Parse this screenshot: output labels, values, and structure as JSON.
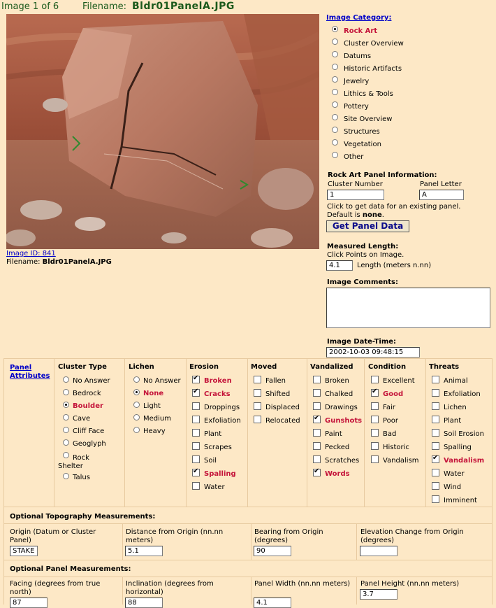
{
  "header": {
    "image_count": "Image 1 of 6",
    "filename_label": "Filename:",
    "filename": "Bldr01PanelA.JPG"
  },
  "image_info": {
    "image_id": "Image ID: 841",
    "filename_label": "Filename:",
    "filename": "Bldr01PanelA.JPG"
  },
  "category": {
    "title": "Image Category:",
    "options": [
      "Rock Art",
      "Cluster Overview",
      "Datums",
      "Historic Artifacts",
      "Jewelry",
      "Lithics & Tools",
      "Pottery",
      "Site Overview",
      "Structures",
      "Vegetation",
      "Other"
    ],
    "selected": 0
  },
  "panel_info": {
    "title": "Rock Art Panel Information:",
    "cluster_label": "Cluster Number",
    "cluster_value": "1",
    "letter_label": "Panel Letter",
    "letter_value": "A",
    "hint_line1": "Click to get data for an existing panel.",
    "hint_default": "Default is ",
    "hint_none": "none",
    "hint_period": ".",
    "button": "Get Panel Data"
  },
  "length": {
    "title": "Measured Length:",
    "hint": "Click Points on Image.",
    "value": "4.1",
    "unit_label": "Length (meters n.nn)"
  },
  "comments": {
    "title": "Image Comments:",
    "value": ""
  },
  "datetime": {
    "title": "Image Date-Time:",
    "value": "2002-10-03 09:48:15"
  },
  "attributes": {
    "title_line1": "Panel",
    "title_line2": "Attributes",
    "cluster_type": {
      "title": "Cluster Type",
      "options": [
        "No Answer",
        "Bedrock",
        "Boulder",
        "Cave",
        "Cliff Face",
        "Geoglyph",
        "Rock Shelter",
        "Talus"
      ],
      "selected": 2
    },
    "lichen": {
      "title": "Lichen",
      "options": [
        "No Answer",
        "None",
        "Light",
        "Medium",
        "Heavy"
      ],
      "selected": 1
    },
    "erosion": {
      "title": "Erosion",
      "options": [
        "Broken",
        "Cracks",
        "Droppings",
        "Exfoliation",
        "Plant",
        "Scrapes",
        "Soil",
        "Spalling",
        "Water"
      ],
      "checked": [
        true,
        true,
        false,
        false,
        false,
        false,
        false,
        true,
        false
      ]
    },
    "moved": {
      "title": "Moved",
      "options": [
        "Fallen",
        "Shifted",
        "Displaced",
        "Relocated"
      ],
      "checked": [
        false,
        false,
        false,
        false
      ]
    },
    "vandalized": {
      "title": "Vandalized",
      "options": [
        "Broken",
        "Chalked",
        "Drawings",
        "Gunshots",
        "Paint",
        "Pecked",
        "Scratches",
        "Words"
      ],
      "checked": [
        false,
        false,
        false,
        true,
        false,
        false,
        false,
        true
      ]
    },
    "condition": {
      "title": "Condition",
      "options": [
        "Excellent",
        "Good",
        "Fair",
        "Poor",
        "Bad",
        "Historic",
        "Vandalism"
      ],
      "checked": [
        false,
        true,
        false,
        false,
        false,
        false,
        false
      ]
    },
    "threats": {
      "title": "Threats",
      "options": [
        "Animal",
        "Exfoliation",
        "Lichen",
        "Plant",
        "Soil Erosion",
        "Spalling",
        "Vandalism",
        "Water",
        "Wind",
        "Imminent"
      ],
      "checked": [
        false,
        false,
        false,
        false,
        false,
        false,
        true,
        false,
        false,
        false
      ]
    }
  },
  "topography": {
    "title": "Optional Topography Measurements:",
    "origin_label": "Origin (Datum or Cluster Panel)",
    "origin_value": "STAKE",
    "distance_label": "Distance from Origin (nn.nn meters)",
    "distance_value": "5.1",
    "bearing_label": "Bearing from Origin (degrees)",
    "bearing_value": "90",
    "elevation_label": "Elevation Change from Origin (degrees)",
    "elevation_value": ""
  },
  "panel_measurements": {
    "title": "Optional Panel Measurements:",
    "facing_label": "Facing (degrees from true north)",
    "facing_value": "87",
    "inclination_label": "Inclination (degrees from horizontal)",
    "inclination_value": "88",
    "width_label": "Panel Width (nn.nn meters)",
    "width_value": "4.1",
    "height_label": "Panel Height (nn.nn meters)",
    "height_value": "3.7"
  },
  "colors": {
    "background": "#fde8c6",
    "link": "#0000c8",
    "selected": "#c4143a",
    "header_text": "#1c5a1c"
  }
}
